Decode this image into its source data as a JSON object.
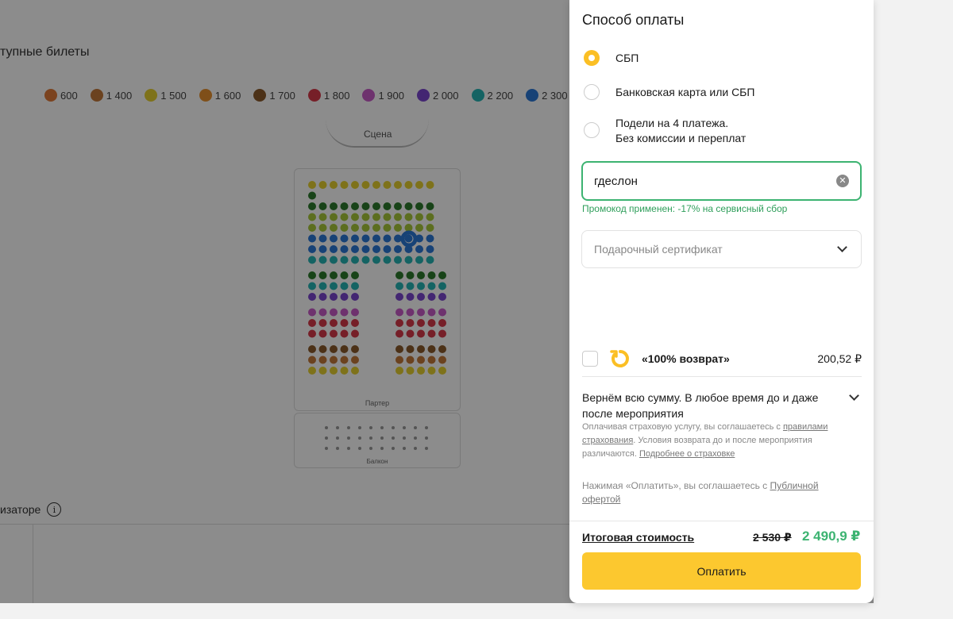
{
  "background": {
    "section_title": "тупные билеты",
    "price_legend": [
      {
        "label": "600",
        "color": "#e07b39"
      },
      {
        "label": "1 400",
        "color": "#c4783a"
      },
      {
        "label": "1 500",
        "color": "#e6d030"
      },
      {
        "label": "1 600",
        "color": "#e8912f"
      },
      {
        "label": "1 700",
        "color": "#8a5a2b"
      },
      {
        "label": "1 800",
        "color": "#d83a4a"
      },
      {
        "label": "1 900",
        "color": "#c95bc8"
      },
      {
        "label": "2 000",
        "color": "#7b45d0"
      },
      {
        "label": "2 200",
        "color": "#26b5b5"
      },
      {
        "label": "2 300",
        "color": "#2b78d8"
      },
      {
        "label": "",
        "color": "#a8c83a"
      }
    ],
    "scene_label": "Сцена",
    "hall_label": "Партер",
    "balcony_label": "Балкон",
    "organizer_text": "изаторе",
    "info_icon": "info-icon"
  },
  "payment": {
    "title": "Способ оплаты",
    "options": [
      {
        "label": "СБП",
        "selected": true
      },
      {
        "label": "Банковская карта или СБП",
        "selected": false
      },
      {
        "label": "Подели на 4 платежа.",
        "label2": "Без комиссии и переплат",
        "selected": false
      }
    ],
    "promo": {
      "value": "гдеслон",
      "message": "Промокод применен: -17% на сервисный сбор"
    },
    "gift_certificate": {
      "placeholder": "Подарочный сертификат"
    },
    "refund": {
      "label": "«100% возврат»",
      "price": "200,52 ₽",
      "description": "Вернём всю сумму. В любое время до и даже после мероприятия",
      "note_prefix": "Оплачивая страховую услугу, вы соглашаетесь с ",
      "note_link1": "правилами страхования",
      "note_middle": ". Условия возврата до и после мероприятия различаются. ",
      "note_link2": "Подробнее о страховке"
    },
    "offer": {
      "prefix": "Нажимая «Оплатить», вы соглашаетесь с ",
      "link": "Публичной офертой"
    },
    "total": {
      "label": "Итоговая стоимость",
      "old_price": "2 530 ₽",
      "new_price": "2 490,9 ₽"
    },
    "pay_button": "Оплатить",
    "accent_color": "#fcc82f",
    "success_color": "#3cb371"
  }
}
